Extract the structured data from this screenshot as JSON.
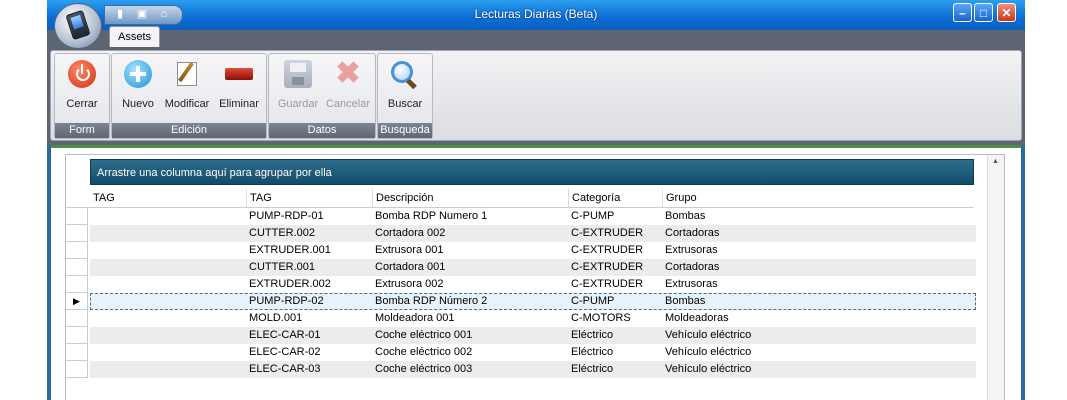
{
  "window": {
    "title": "Lecturas Diarias (Beta)",
    "min_label": "–",
    "max_label": "□",
    "close_label": "✕"
  },
  "quick_access": {
    "items": [
      "save-icon",
      "image-icon",
      "home-icon"
    ]
  },
  "ribbon": {
    "tab": "Assets",
    "groups": [
      {
        "label": "Form",
        "buttons": [
          {
            "label": "Cerrar",
            "icon": "power-icon"
          }
        ]
      },
      {
        "label": "Edición",
        "buttons": [
          {
            "label": "Nuevo",
            "icon": "plus-icon"
          },
          {
            "label": "Modificar",
            "icon": "edit-icon"
          },
          {
            "label": "Eliminar",
            "icon": "delete-icon"
          }
        ]
      },
      {
        "label": "Datos",
        "buttons": [
          {
            "label": "Guardar",
            "icon": "save-icon",
            "disabled": true
          },
          {
            "label": "Cancelar",
            "icon": "cancel-icon",
            "disabled": true
          }
        ]
      },
      {
        "label": "Busqueda",
        "buttons": [
          {
            "label": "Buscar",
            "icon": "search-icon"
          }
        ]
      }
    ]
  },
  "grid": {
    "group_panel_text": "Arrastre una columna aquí para agrupar por ella",
    "columns": [
      "TAG",
      "TAG",
      "Descripción",
      "Categoría",
      "Grupo"
    ],
    "rows": [
      [
        "",
        "PUMP-RDP-01",
        "Bomba RDP Numero 1",
        "C-PUMP",
        "Bombas"
      ],
      [
        "",
        "CUTTER.002",
        "Cortadora 002",
        "C-EXTRUDER",
        "Cortadoras"
      ],
      [
        "",
        "EXTRUDER.001",
        "Extrusora 001",
        "C-EXTRUDER",
        "Extrusoras"
      ],
      [
        "",
        "CUTTER.001",
        "Cortadora 001",
        "C-EXTRUDER",
        "Cortadoras"
      ],
      [
        "",
        "EXTRUDER.002",
        "Extrusora 002",
        "C-EXTRUDER",
        "Extrusoras"
      ],
      [
        "",
        "PUMP-RDP-02",
        "Bomba RDP Número 2",
        "C-PUMP",
        "Bombas"
      ],
      [
        "",
        "MOLD.001",
        "Moldeadora 001",
        "C-MOTORS",
        "Moldeadoras"
      ],
      [
        "",
        "ELEC-CAR-01",
        "Coche eléctrico 001",
        "Eléctrico",
        "Vehículo eléctrico"
      ],
      [
        "",
        "ELEC-CAR-02",
        "Coche eléctrico 002",
        "Eléctrico",
        "Vehículo eléctrico"
      ],
      [
        "",
        "ELEC-CAR-03",
        "Coche eléctrico 003",
        "Eléctrico",
        "Vehículo eléctrico"
      ]
    ],
    "current_row": 5,
    "row_indicator": "▶"
  }
}
